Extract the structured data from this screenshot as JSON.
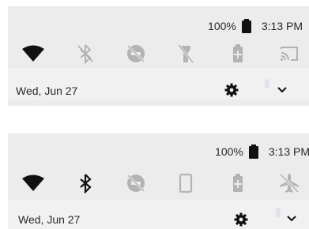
{
  "panels": [
    {
      "status": {
        "battery": "100%",
        "time": "3:13 PM"
      },
      "tiles": [
        {
          "icon": "wifi-icon",
          "state": "on"
        },
        {
          "icon": "bluetooth-off-icon",
          "state": "off"
        },
        {
          "icon": "do-not-disturb-off-icon",
          "state": "off"
        },
        {
          "icon": "flashlight-off-icon",
          "state": "off"
        },
        {
          "icon": "battery-saver-icon",
          "state": "off"
        },
        {
          "icon": "cast-icon",
          "state": "off"
        }
      ],
      "date": "Wed, Jun 27"
    },
    {
      "status": {
        "battery": "100%",
        "time": "3:13 PM"
      },
      "tiles": [
        {
          "icon": "wifi-icon",
          "state": "on"
        },
        {
          "icon": "bluetooth-icon",
          "state": "on"
        },
        {
          "icon": "do-not-disturb-off-icon",
          "state": "off"
        },
        {
          "icon": "auto-rotate-icon",
          "state": "off"
        },
        {
          "icon": "battery-saver-icon",
          "state": "off"
        },
        {
          "icon": "airplane-mode-off-icon",
          "state": "off"
        }
      ],
      "date": "Wed, Jun 27"
    }
  ],
  "colors": {
    "active": "#111111",
    "inactive": "#b3b3b3",
    "shade": "#ececec",
    "text": "#2a2a2a"
  }
}
